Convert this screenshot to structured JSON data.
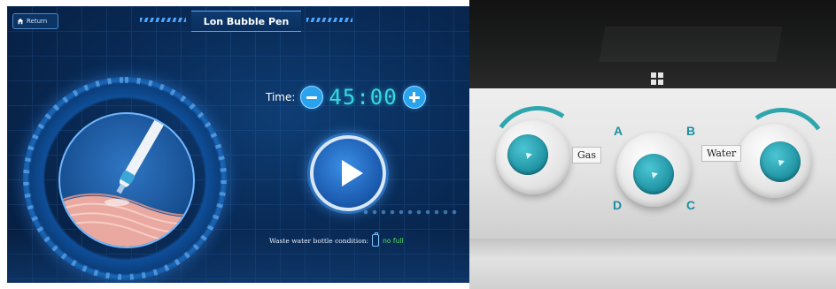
{
  "device_ui": {
    "return_label": "Return",
    "title": "Lon Bubble Pen",
    "time_label": "Time:",
    "time_value": "45:00",
    "waste_label": "Waste water bottle condition:",
    "waste_status": "no full"
  },
  "photo": {
    "labels": {
      "gas": "Gas",
      "water": "Water",
      "a": "A",
      "b": "B",
      "c": "C",
      "d": "D"
    }
  },
  "colors": {
    "ui_background": "#092b57",
    "accent_cyan": "#35d7e8",
    "button_blue": "#2aa3ee",
    "status_green": "#55e063",
    "knob_teal": "#1d8f9f"
  }
}
